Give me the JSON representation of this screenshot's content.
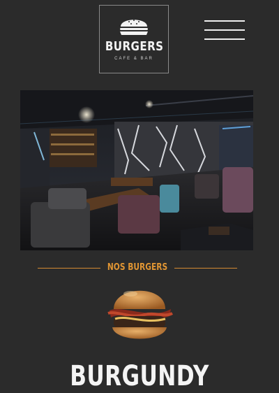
{
  "header": {
    "logo": {
      "title": "BURGERS",
      "subtitle": "CAFE & BAR"
    },
    "menu_icon": "hamburger-menu-icon"
  },
  "hero": {
    "image": "restaurant-interior-photo"
  },
  "section": {
    "title": "NOS BURGERS",
    "accent_color": "#d58a33"
  },
  "product": {
    "image": "burger-photo",
    "name": "BURGUNDY"
  },
  "colors": {
    "background": "#2b2b2b",
    "accent": "#e09533",
    "text": "#f4f4f4"
  }
}
